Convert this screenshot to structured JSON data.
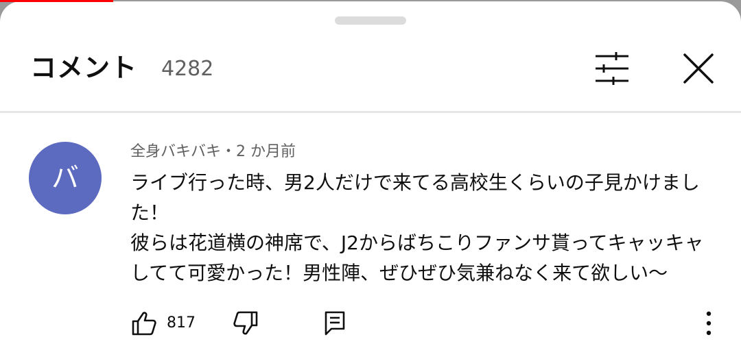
{
  "header": {
    "title": "コメント",
    "count": "4282"
  },
  "comment": {
    "avatar_letter": "バ",
    "avatar_color": "#5c6bc0",
    "meta": "全身バキバキ・2 か月前",
    "lines": [
      "ライブ行った時、男2人だけで来てる高校生くらいの子見かけまし",
      "た！",
      "彼らは花道横の神席で、J2からばちこりファンサ貰ってキャッキャ",
      "してて可愛かった！男性陣、ぜひぜひ気兼ねなく来て欲しい〜"
    ],
    "like_count": "817"
  },
  "icons": {
    "filter": "sliders-icon",
    "close": "close-icon",
    "like": "thumbs-up-icon",
    "dislike": "thumbs-down-icon",
    "reply": "reply-icon",
    "more": "more-vertical-icon"
  },
  "colors": {
    "progress": "#ff0000",
    "text_primary": "#0f0f0f",
    "text_secondary": "#606060"
  }
}
